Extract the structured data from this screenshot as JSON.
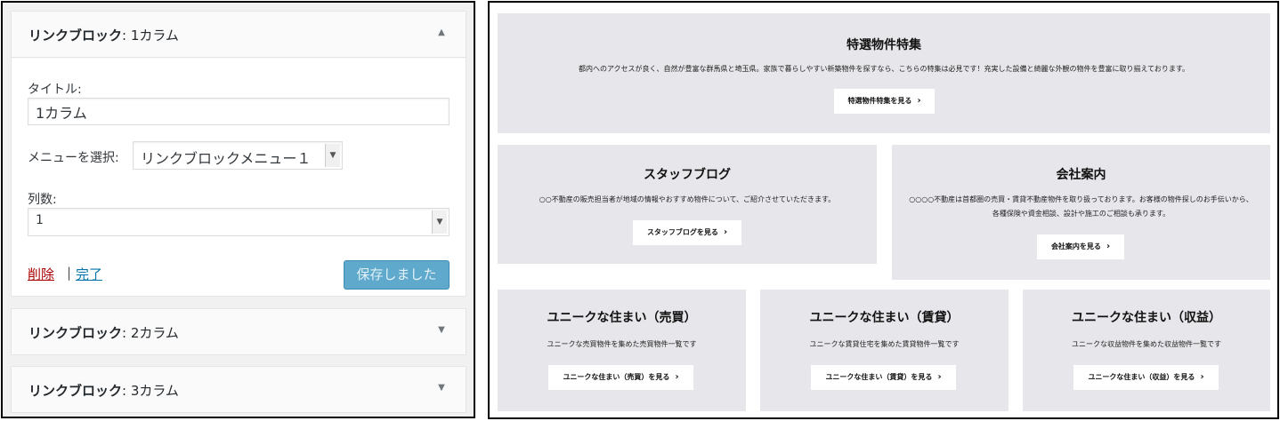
{
  "left": {
    "widgets": [
      {
        "title_bold": "リンクブロック",
        "title_rest": ": 1カラム",
        "toggle_icon": "▲"
      },
      {
        "title_bold": "リンクブロック",
        "title_rest": ": 2カラム",
        "toggle_icon": "▼"
      },
      {
        "title_bold": "リンクブロック",
        "title_rest": ": 3カラム",
        "toggle_icon": "▼"
      }
    ],
    "form": {
      "title_label": "タイトル:",
      "title_value": "1カラム",
      "menu_label": "メニューを選択:",
      "menu_selected": "リンクブロックメニュー１",
      "columns_label": "列数:",
      "columns_selected": "1",
      "delete_link": "削除",
      "separator": "|",
      "done_link": "完了",
      "save_button": "保存しました"
    }
  },
  "right": {
    "blocks": [
      {
        "title": "特選物件特集",
        "desc": [
          "都内へのアクセスが良く、自然が豊富な群馬県と埼玉県。家族で暮らしやすい新築物件を探すなら、こちらの特集は必見です！充実した設備と綺麗な外観の物件を豊富に取り揃えております。"
        ],
        "button": "特選物件特集を見る"
      },
      {
        "title": "スタッフブログ",
        "desc": [
          "○○不動産の販売担当者が地域の情報やおすすめ物件について、ご紹介させていただきます。"
        ],
        "button": "スタッフブログを見る"
      },
      {
        "title": "会社案内",
        "desc": [
          "○○○○不動産は首都圏の売買・賃貸不動産物件を取り扱っております。お客様の物件探しのお手伝いから、",
          "各種保険や資金相談、設計や施工のご相談も承ります。"
        ],
        "button": "会社案内を見る"
      },
      {
        "title": "ユニークな住まい（売買）",
        "desc": [
          "ユニークな売買物件を集めた売買物件一覧です"
        ],
        "button": "ユニークな住まい（売買）を見る"
      },
      {
        "title": "ユニークな住まい（賃貸）",
        "desc": [
          "ユニークな賃貸住宅を集めた賃貸物件一覧です"
        ],
        "button": "ユニークな住まい（賃貸）を見る"
      },
      {
        "title": "ユニークな住まい（収益）",
        "desc": [
          "ユニークな収益物件を集めた収益物件一覧です"
        ],
        "button": "ユニークな住まい（収益）を見る"
      }
    ],
    "chevron_icon": "›"
  },
  "colors": {
    "panel_bg": "#f1f1f1",
    "block_bg": "#e7e6ea",
    "save_button": "#5ea9cc",
    "delete_link": "#aa0000",
    "done_link": "#0073aa"
  }
}
